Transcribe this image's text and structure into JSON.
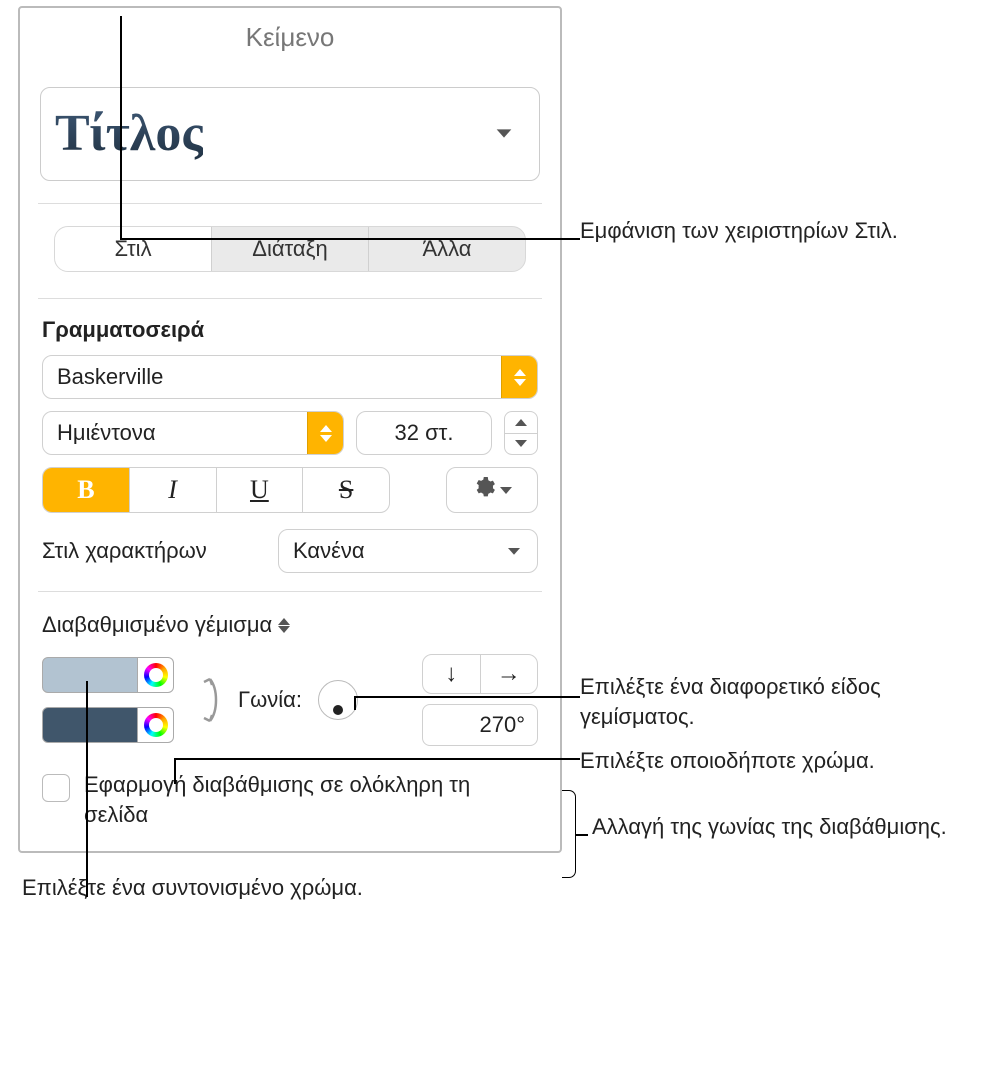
{
  "panel": {
    "title": "Κείμενο",
    "paragraphStyle": "Τίτλος",
    "tabs": {
      "style": "Στιλ",
      "layout": "Διάταξη",
      "more": "Άλλα"
    },
    "font": {
      "section": "Γραμματοσειρά",
      "family": "Baskerville",
      "weight": "Ημιέντονα",
      "size": "32 στ.",
      "bold": "B",
      "italic": "I",
      "underline": "U",
      "strike": "S"
    },
    "charStyle": {
      "label": "Στιλ χαρακτήρων",
      "value": "Κανένα"
    },
    "fill": {
      "type": "Διαβαθμισμένο γέμισμα",
      "angleLabel": "Γωνία:",
      "angleValue": "270°",
      "dirDown": "↓",
      "dirRight": "→",
      "checkbox": "Εφαρμογή διαβάθμισης σε ολόκληρη τη σελίδα"
    }
  },
  "callouts": {
    "styleTab": "Εμφάνιση των χειριστηρίων Στιλ.",
    "fillType": "Επιλέξτε ένα διαφορετικό είδος γεμίσματος.",
    "anyColor": "Επιλέξτε οποιοδήποτε χρώμα.",
    "angle": "Αλλαγή της γωνίας της διαβάθμισης.",
    "coordColor": "Επιλέξτε ένα συντονισμένο χρώμα."
  }
}
